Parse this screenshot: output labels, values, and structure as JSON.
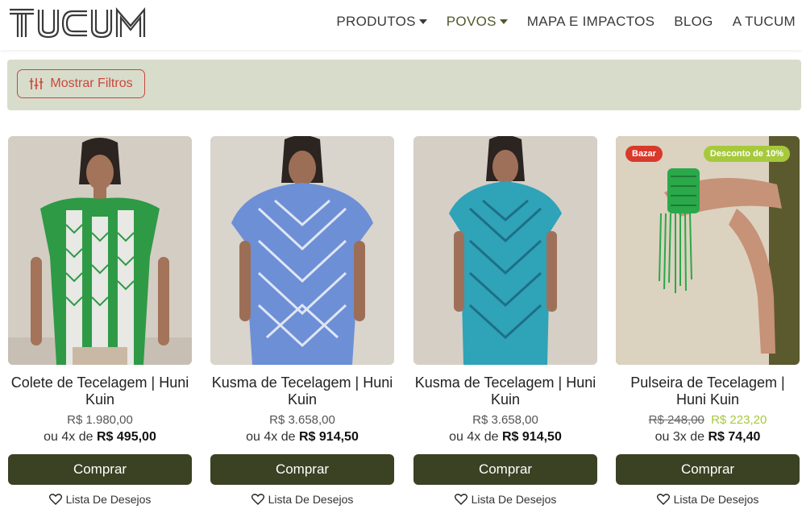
{
  "brand": {
    "logo_text": "TUCUM"
  },
  "nav": [
    {
      "label": "PRODUTOS",
      "has_dropdown": true,
      "active": false
    },
    {
      "label": "POVOS",
      "has_dropdown": true,
      "active": true
    },
    {
      "label": "MAPA E IMPACTOS",
      "has_dropdown": false,
      "active": false
    },
    {
      "label": "BLOG",
      "has_dropdown": false,
      "active": false
    },
    {
      "label": "A TUCUM",
      "has_dropdown": false,
      "active": false
    }
  ],
  "filters": {
    "button_label": "Mostrar Filtros"
  },
  "products": [
    {
      "name": "Colete de Tecelagem | Huni Kuin",
      "price": "R$ 1.980,00",
      "installment_prefix": "ou 4x de",
      "installment_value": "R$ 495,00",
      "buy_label": "Comprar",
      "wishlist_label": "Lista De Desejos",
      "image_palette": {
        "wall": "#d4cdc3",
        "garment": "#2e9a46",
        "pattern": "#e8e8e4",
        "skin": "#a3735a"
      }
    },
    {
      "name": "Kusma de Tecelagem | Huni Kuin",
      "price": "R$ 3.658,00",
      "installment_prefix": "ou 4x de",
      "installment_value": "R$ 914,50",
      "buy_label": "Comprar",
      "wishlist_label": "Lista De Desejos",
      "image_palette": {
        "wall": "#d9d4cc",
        "garment": "#6d8fd6",
        "pattern": "#dfe6f5",
        "skin": "#9c6e56"
      }
    },
    {
      "name": "Kusma de Tecelagem | Huni Kuin",
      "price": "R$ 3.658,00",
      "installment_prefix": "ou 4x de",
      "installment_value": "R$ 914,50",
      "buy_label": "Comprar",
      "wishlist_label": "Lista De Desejos",
      "image_palette": {
        "wall": "#d6cfc6",
        "garment": "#2fa3b8",
        "pattern": "#1e6f86",
        "skin": "#9f7059"
      }
    },
    {
      "name": "Pulseira de Tecelagem | Huni Kuin",
      "old_price": "R$ 248,00",
      "price": "R$ 223,20",
      "installment_prefix": "ou 3x de",
      "installment_value": "R$ 74,40",
      "buy_label": "Comprar",
      "wishlist_label": "Lista De Desejos",
      "badges": [
        "Bazar",
        "Desconto de 10%"
      ],
      "image_palette": {
        "wall": "#5b5a2e",
        "garment": "#dcd2c0",
        "pattern": "#2aa84a",
        "skin": "#c69278"
      }
    }
  ],
  "colors": {
    "brand_olive": "#3b4224",
    "accent_red": "#c9483b",
    "filter_bg": "#d8dccb",
    "sale_green": "#a6c93c",
    "badge_red": "#d9392b"
  }
}
